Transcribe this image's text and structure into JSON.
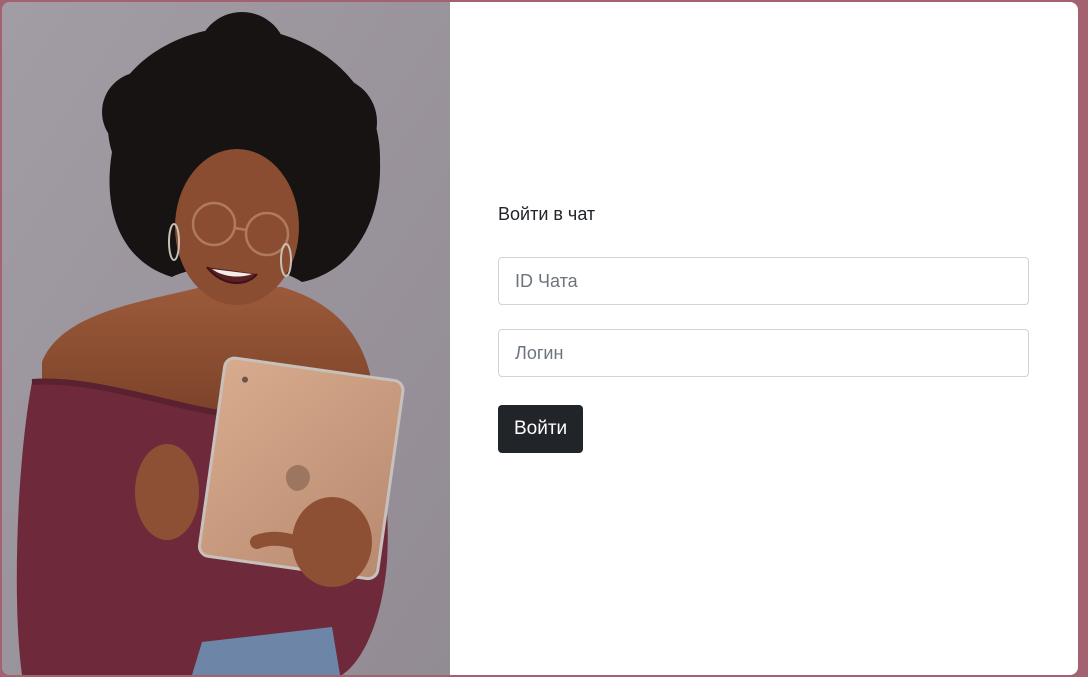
{
  "login": {
    "title": "Войти в чат",
    "chat_id_placeholder": "ID Чата",
    "chat_id_value": "",
    "login_placeholder": "Логин",
    "login_value": "",
    "submit_label": "Войти"
  },
  "colors": {
    "page_background": "#a4616f",
    "card_background": "#ffffff",
    "button_background": "#212529",
    "input_border": "#ced4da"
  },
  "illustration": {
    "description_icon": "woman-with-tablet-photo"
  }
}
